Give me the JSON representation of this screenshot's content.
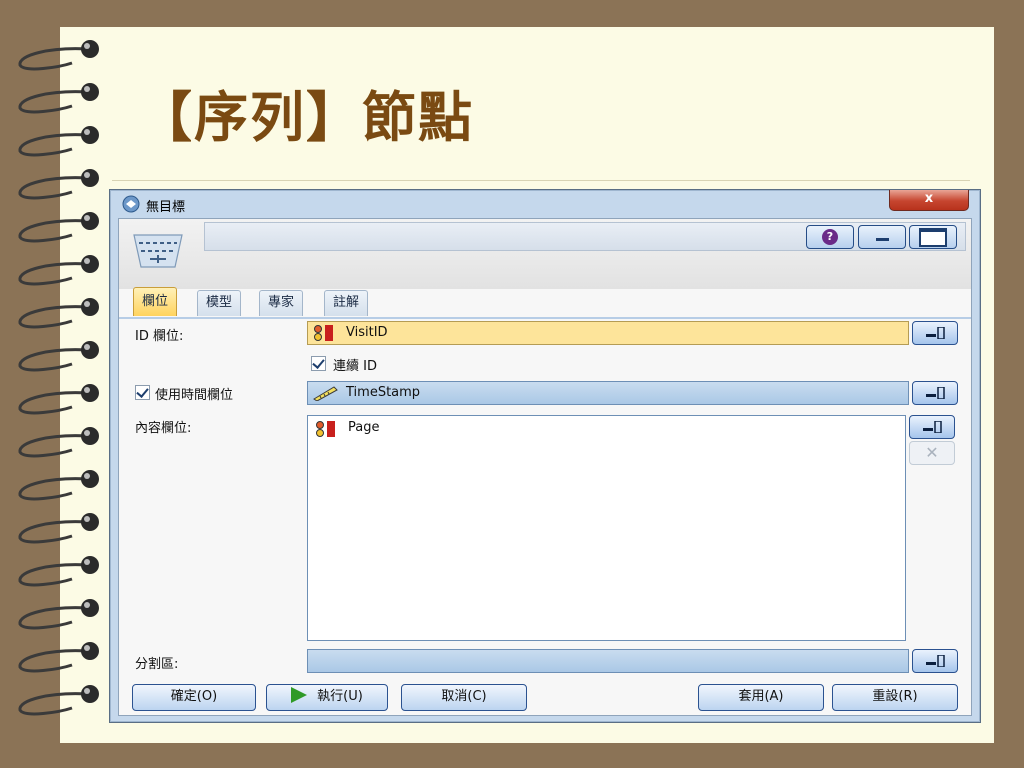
{
  "slide": {
    "title": "【序列】節點"
  },
  "window": {
    "title": "無目標",
    "close_label": "x"
  },
  "header": {
    "name_value": "",
    "help_label": "?"
  },
  "tabs": [
    {
      "label": "欄位",
      "active": true
    },
    {
      "label": "模型",
      "active": false
    },
    {
      "label": "專家",
      "active": false
    },
    {
      "label": "註解",
      "active": false
    }
  ],
  "fields": {
    "id_field_label": "ID 欄位:",
    "id_field_value": "VisitID",
    "contiguous_id_label": "連續 ID",
    "contiguous_id_checked": true,
    "use_time_label": "使用時間欄位",
    "use_time_checked": true,
    "time_field_value": "TimeStamp",
    "content_label": "內容欄位:",
    "content_items": [
      "Page"
    ],
    "partition_label": "分割區:",
    "partition_value": "",
    "remove_label": "✕"
  },
  "buttons": {
    "ok": "確定(O)",
    "run": "執行(U)",
    "cancel": "取消(C)",
    "apply": "套用(A)",
    "reset": "重設(R)"
  },
  "colors": {
    "slide_bg": "#fcfbe5",
    "outer_bg": "#8b7356",
    "title_color": "#7a4a12",
    "selected_field": "#fde49a",
    "active_tab": "#ffd35e"
  }
}
